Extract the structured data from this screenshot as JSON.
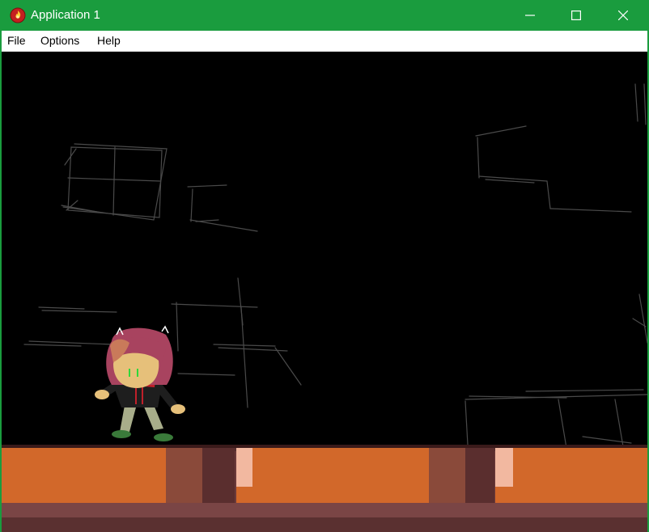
{
  "window": {
    "title": "Application 1",
    "accent_color": "#1a9c3e",
    "icon": "app-flame-icon"
  },
  "window_controls": {
    "minimize_icon": "minimize-icon",
    "maximize_icon": "maximize-icon",
    "close_icon": "close-icon"
  },
  "menu": {
    "items": [
      "File",
      "Options",
      "Help"
    ]
  },
  "game": {
    "background_color": "#000000",
    "sketch_color": "#4a4a4a",
    "floor": {
      "brick_color": "#d2682a",
      "mortar_color": "#6b3a3a",
      "highlight_color": "#f2b8a0"
    },
    "character": {
      "hair_color": "#a8435f",
      "skin_color": "#e6c07a",
      "jacket_color": "#1e1e1e",
      "accent_color": "#c0202a",
      "pants_color": "#a8ad8a",
      "shoes_color": "#3a7a3a"
    }
  }
}
